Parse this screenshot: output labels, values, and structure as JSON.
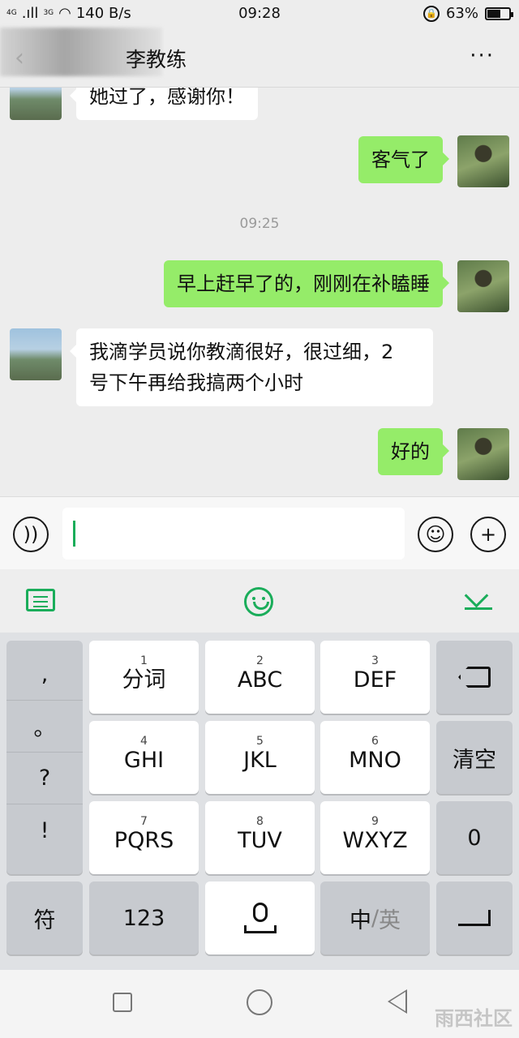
{
  "status_bar": {
    "signal_1": "4G",
    "signal_2": "3G",
    "net_speed": "140 B/s",
    "time": "09:28",
    "battery": "63%",
    "battery_level": 0.63
  },
  "header": {
    "back_icon": "chevron-left-icon",
    "contact_name": "李教练",
    "more_label": "···"
  },
  "messages": [
    {
      "side": "left",
      "text": "她过了，感谢你！"
    },
    {
      "side": "right",
      "text": "客气了"
    },
    {
      "side": "time",
      "text": "09:25"
    },
    {
      "side": "right",
      "text": "早上赶早了的，刚刚在补瞌睡"
    },
    {
      "side": "left",
      "text_line1": "我滴学员说你教滴很好，很过细，2",
      "text_line2": "号下午再给我搞两个小时"
    },
    {
      "side": "right",
      "text": "好的"
    }
  ],
  "input_bar": {
    "voice_icon": "voice-icon",
    "emoji_icon": "emoji-icon",
    "plus_label": "+"
  },
  "ime_toolbar": {
    "keyboard_icon": "keyboard-icon",
    "emoji_icon": "smile-icon",
    "collapse_icon": "collapse-icon"
  },
  "keyboard": {
    "punct": [
      ",",
      "。",
      "?",
      "!"
    ],
    "keys": [
      {
        "num": "1",
        "label": "分词"
      },
      {
        "num": "2",
        "label": "ABC"
      },
      {
        "num": "3",
        "label": "DEF"
      },
      {
        "num": "4",
        "label": "GHI"
      },
      {
        "num": "5",
        "label": "JKL"
      },
      {
        "num": "6",
        "label": "MNO"
      },
      {
        "num": "7",
        "label": "PQRS"
      },
      {
        "num": "8",
        "label": "TUV"
      },
      {
        "num": "9",
        "label": "WXYZ"
      }
    ],
    "clear": "清空",
    "zero": "0",
    "symbol": "符",
    "numeric": "123",
    "lang_zh": "中",
    "lang_sep": "/",
    "lang_en": "英"
  },
  "watermark": "雨西社区",
  "colors": {
    "accent": "#1aad5a",
    "bubble_self": "#95ec69",
    "bubble_other": "#ffffff",
    "background": "#ededed"
  }
}
